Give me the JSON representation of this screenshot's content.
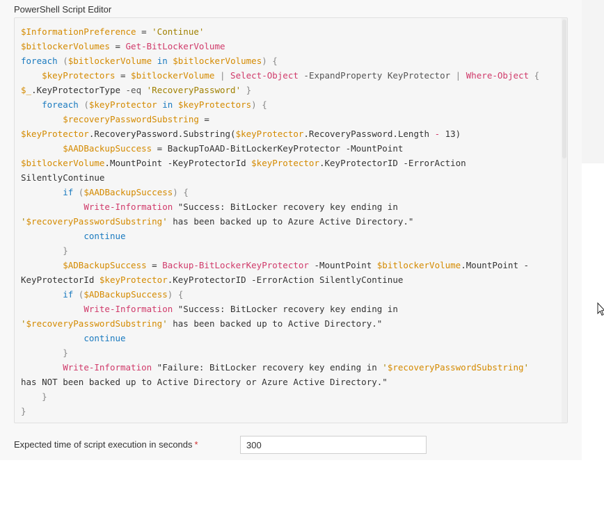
{
  "editor": {
    "label": "PowerShell Script Editor",
    "lines": [
      [
        {
          "t": "var",
          "s": "$InformationPreference"
        },
        {
          "t": "default",
          "s": " = "
        },
        {
          "t": "string",
          "s": "'Continue'"
        }
      ],
      [
        {
          "t": "var",
          "s": "$bitlockerVolumes"
        },
        {
          "t": "default",
          "s": " = "
        },
        {
          "t": "cmdlet",
          "s": "Get-BitLockerVolume"
        }
      ],
      [
        {
          "t": "keyword",
          "s": "foreach"
        },
        {
          "t": "punct",
          "s": " ("
        },
        {
          "t": "var",
          "s": "$bitlockerVolume"
        },
        {
          "t": "keyword",
          "s": " in "
        },
        {
          "t": "var",
          "s": "$bitlockerVolumes"
        },
        {
          "t": "punct",
          "s": ") {"
        }
      ],
      [
        {
          "t": "default",
          "s": "    "
        },
        {
          "t": "var",
          "s": "$keyProtectors"
        },
        {
          "t": "default",
          "s": " = "
        },
        {
          "t": "var",
          "s": "$bitlockerVolume"
        },
        {
          "t": "punct",
          "s": " | "
        },
        {
          "t": "cmdlet",
          "s": "Select-Object"
        },
        {
          "t": "param",
          "s": " -ExpandProperty KeyProtector "
        },
        {
          "t": "punct",
          "s": "| "
        },
        {
          "t": "cmdlet",
          "s": "Where-Object"
        },
        {
          "t": "punct",
          "s": " {"
        }
      ],
      [
        {
          "t": "var",
          "s": "$_"
        },
        {
          "t": "default",
          "s": ".KeyProtectorType "
        },
        {
          "t": "param",
          "s": "-eq "
        },
        {
          "t": "string",
          "s": "'RecoveryPassword'"
        },
        {
          "t": "punct",
          "s": " }"
        }
      ],
      [
        {
          "t": "default",
          "s": "    "
        },
        {
          "t": "keyword",
          "s": "foreach"
        },
        {
          "t": "punct",
          "s": " ("
        },
        {
          "t": "var",
          "s": "$keyProtector"
        },
        {
          "t": "keyword",
          "s": " in "
        },
        {
          "t": "var",
          "s": "$keyProtectors"
        },
        {
          "t": "punct",
          "s": ") {"
        }
      ],
      [
        {
          "t": "default",
          "s": "        "
        },
        {
          "t": "var",
          "s": "$recoveryPasswordSubstring"
        },
        {
          "t": "default",
          "s": " ="
        }
      ],
      [
        {
          "t": "var",
          "s": "$keyProtector"
        },
        {
          "t": "default",
          "s": ".RecoveryPassword.Substring("
        },
        {
          "t": "var",
          "s": "$keyProtector"
        },
        {
          "t": "default",
          "s": ".RecoveryPassword.Length "
        },
        {
          "t": "op",
          "s": "-"
        },
        {
          "t": "default",
          "s": " 13)"
        }
      ],
      [
        {
          "t": "default",
          "s": "        "
        },
        {
          "t": "var",
          "s": "$AADBackupSuccess"
        },
        {
          "t": "default",
          "s": " = BackupToAAD-BitLockerKeyProtector -MountPoint"
        }
      ],
      [
        {
          "t": "var",
          "s": "$bitlockerVolume"
        },
        {
          "t": "default",
          "s": ".MountPoint -KeyProtectorId "
        },
        {
          "t": "var",
          "s": "$keyProtector"
        },
        {
          "t": "default",
          "s": ".KeyProtectorID -ErrorAction"
        }
      ],
      [
        {
          "t": "default",
          "s": "SilentlyContinue"
        }
      ],
      [
        {
          "t": "default",
          "s": "        "
        },
        {
          "t": "keyword",
          "s": "if"
        },
        {
          "t": "punct",
          "s": " ("
        },
        {
          "t": "var",
          "s": "$AADBackupSuccess"
        },
        {
          "t": "punct",
          "s": ") {"
        }
      ],
      [
        {
          "t": "default",
          "s": "            "
        },
        {
          "t": "cmdlet",
          "s": "Write-Information"
        },
        {
          "t": "default",
          "s": " \"Success: BitLocker recovery key ending in"
        }
      ],
      [
        {
          "t": "string",
          "s": "'"
        },
        {
          "t": "var",
          "s": "$recoveryPasswordSubstring"
        },
        {
          "t": "string",
          "s": "'"
        },
        {
          "t": "default",
          "s": " has been backed up to Azure Active Directory.\""
        }
      ],
      [
        {
          "t": "default",
          "s": "            "
        },
        {
          "t": "keyword",
          "s": "continue"
        }
      ],
      [
        {
          "t": "punct",
          "s": "        }"
        }
      ],
      [
        {
          "t": "default",
          "s": "        "
        },
        {
          "t": "var",
          "s": "$ADBackupSuccess"
        },
        {
          "t": "default",
          "s": " = "
        },
        {
          "t": "cmdlet",
          "s": "Backup-BitLockerKeyProtector"
        },
        {
          "t": "default",
          "s": " -MountPoint "
        },
        {
          "t": "var",
          "s": "$bitlockerVolume"
        },
        {
          "t": "default",
          "s": ".MountPoint -"
        }
      ],
      [
        {
          "t": "default",
          "s": "KeyProtectorId "
        },
        {
          "t": "var",
          "s": "$keyProtector"
        },
        {
          "t": "default",
          "s": ".KeyProtectorID -ErrorAction SilentlyContinue"
        }
      ],
      [
        {
          "t": "default",
          "s": "        "
        },
        {
          "t": "keyword",
          "s": "if"
        },
        {
          "t": "punct",
          "s": " ("
        },
        {
          "t": "var",
          "s": "$ADBackupSuccess"
        },
        {
          "t": "punct",
          "s": ") {"
        }
      ],
      [
        {
          "t": "default",
          "s": "            "
        },
        {
          "t": "cmdlet",
          "s": "Write-Information"
        },
        {
          "t": "default",
          "s": " \"Success: BitLocker recovery key ending in"
        }
      ],
      [
        {
          "t": "string",
          "s": "'"
        },
        {
          "t": "var",
          "s": "$recoveryPasswordSubstring"
        },
        {
          "t": "string",
          "s": "'"
        },
        {
          "t": "default",
          "s": " has been backed up to Active Directory.\""
        }
      ],
      [
        {
          "t": "default",
          "s": "            "
        },
        {
          "t": "keyword",
          "s": "continue"
        }
      ],
      [
        {
          "t": "punct",
          "s": "        }"
        }
      ],
      [
        {
          "t": "default",
          "s": "        "
        },
        {
          "t": "cmdlet",
          "s": "Write-Information"
        },
        {
          "t": "default",
          "s": " \"Failure: BitLocker recovery key ending in "
        },
        {
          "t": "string",
          "s": "'"
        },
        {
          "t": "var",
          "s": "$recoveryPasswordSubstring"
        },
        {
          "t": "string",
          "s": "'"
        }
      ],
      [
        {
          "t": "default",
          "s": "has NOT been backed up to Active Directory or Azure Active Directory.\""
        }
      ],
      [
        {
          "t": "punct",
          "s": "    }"
        }
      ],
      [
        {
          "t": "punct",
          "s": "}"
        }
      ]
    ]
  },
  "execution_time": {
    "label": "Expected time of script execution in seconds",
    "required_marker": "*",
    "value": "300"
  },
  "icons": {
    "cursor": "mouse-pointer-icon"
  }
}
